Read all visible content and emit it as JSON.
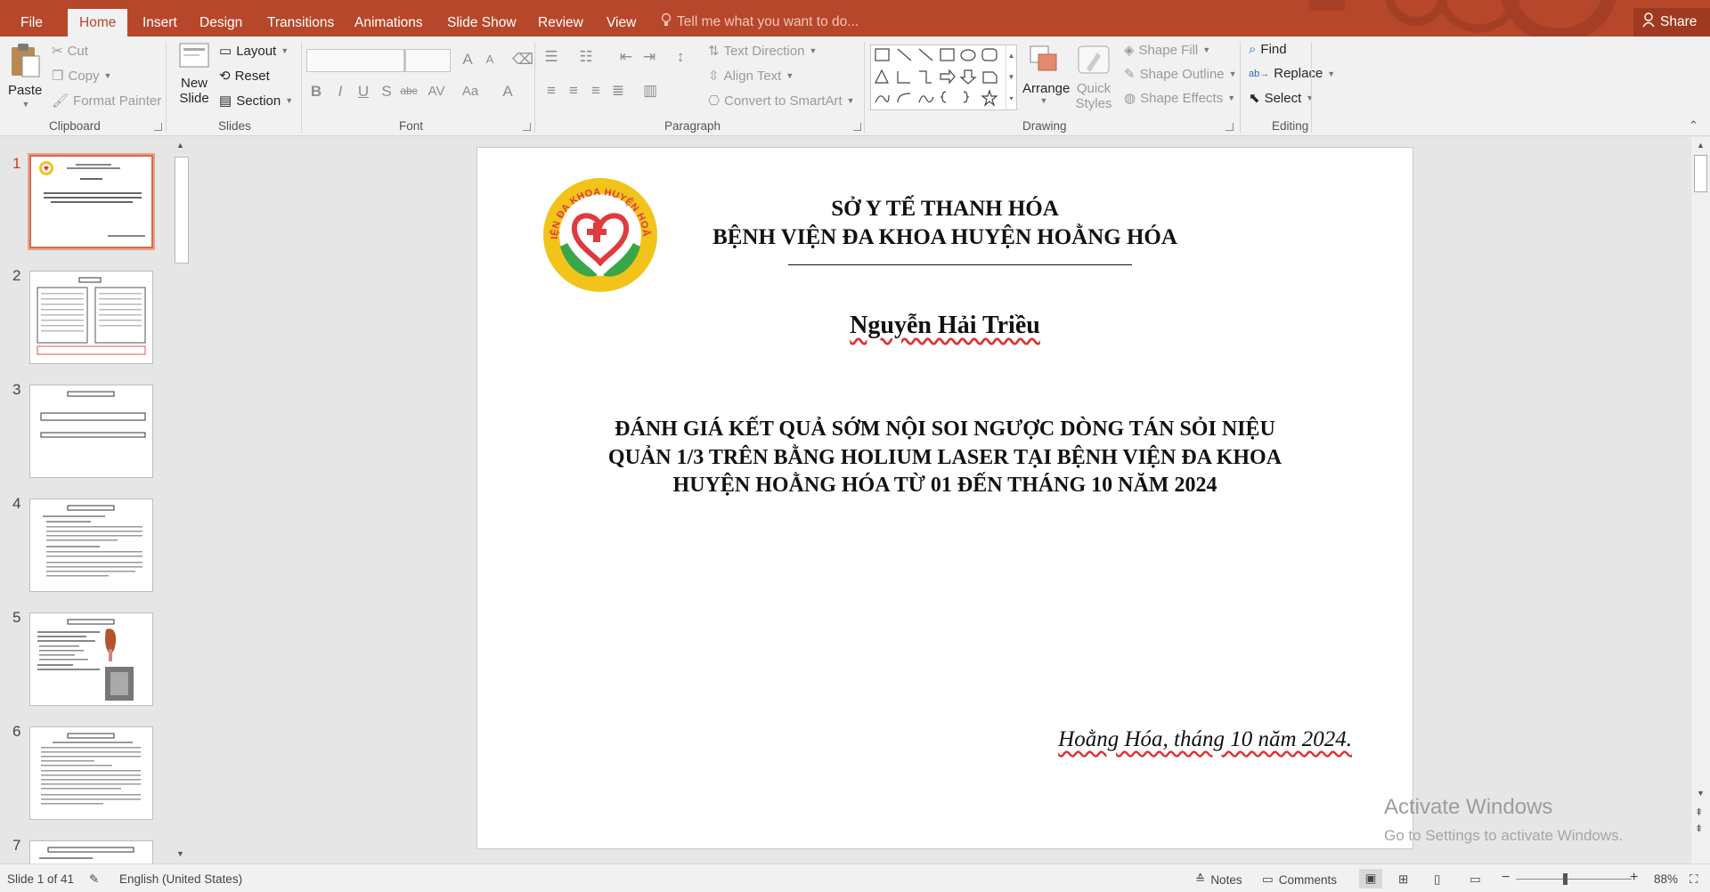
{
  "menu": {
    "file": "File",
    "tabs": [
      "Home",
      "Insert",
      "Design",
      "Transitions",
      "Animations",
      "Slide Show",
      "Review",
      "View"
    ],
    "active_tab": "Home",
    "tell_me": "Tell me what you want to do...",
    "share": "Share"
  },
  "ribbon": {
    "clipboard": {
      "paste": "Paste",
      "cut": "Cut",
      "copy": "Copy",
      "format_painter": "Format Painter",
      "label": "Clipboard"
    },
    "slides": {
      "new_slide_1": "New",
      "new_slide_2": "Slide",
      "layout": "Layout",
      "reset": "Reset",
      "section": "Section",
      "label": "Slides"
    },
    "font": {
      "label": "Font",
      "font_name": "",
      "font_size": ""
    },
    "paragraph": {
      "text_direction": "Text Direction",
      "align_text": "Align Text",
      "convert_smartart": "Convert to SmartArt",
      "label": "Paragraph"
    },
    "drawing": {
      "arrange": "Arrange",
      "quick_styles_1": "Quick",
      "quick_styles_2": "Styles",
      "shape_fill": "Shape Fill",
      "shape_outline": "Shape Outline",
      "shape_effects": "Shape Effects",
      "label": "Drawing"
    },
    "editing": {
      "find": "Find",
      "replace": "Replace",
      "select": "Select",
      "label": "Editing"
    }
  },
  "thumbnails": [
    {
      "number": "1",
      "selected": true
    },
    {
      "number": "2",
      "selected": false
    },
    {
      "number": "3",
      "selected": false
    },
    {
      "number": "4",
      "selected": false
    },
    {
      "number": "5",
      "selected": false
    },
    {
      "number": "6",
      "selected": false
    },
    {
      "number": "7",
      "selected": false
    }
  ],
  "slide": {
    "header_line1": "SỞ Y TẾ THANH HÓA",
    "header_line2": "BỆNH VIỆN ĐA KHOA HUYỆN HOẰNG HÓA",
    "logo_text": "BỆNH VIỆN ĐA KHOA HUYỆN HOẰNG HÓA",
    "author": "Nguyễn Hải Triều",
    "title_line1": "ĐÁNH GIÁ KẾT QUẢ SỚM NỘI SOI NGƯỢC DÒNG TÁN SỎI NIỆU",
    "title_line2": "QUẢN 1/3 TRÊN BẰNG HOLIUM LASER TẠI BỆNH VIỆN ĐA KHOA",
    "title_line3": "HUYỆN HOẰNG HÓA TỪ 01 ĐẾN THÁNG 10 NĂM 2024",
    "date_place": "Hoằng Hóa, tháng 10 năm 2024."
  },
  "watermark": {
    "line1": "Activate Windows",
    "line2": "Go to Settings to activate Windows."
  },
  "status": {
    "slide_counter": "Slide 1 of 41",
    "language": "English (United States)",
    "notes": "Notes",
    "comments": "Comments",
    "zoom": "88%"
  },
  "colors": {
    "accent": "#b7472a",
    "selection": "#d26d4f",
    "logo_ring": "#f2c419",
    "logo_heart": "#e03a3e",
    "logo_hands": "#3aa64a"
  }
}
